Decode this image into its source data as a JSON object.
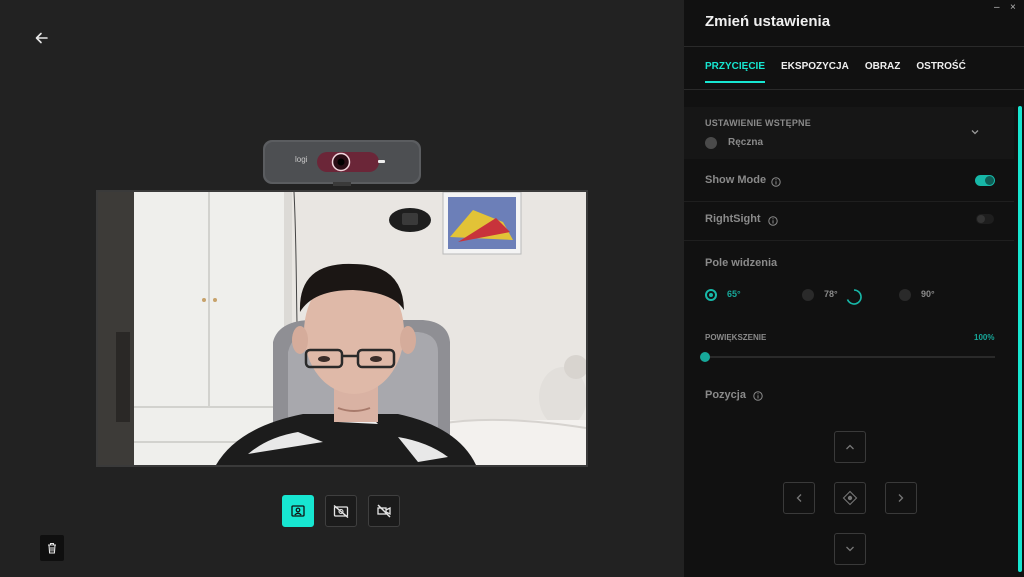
{
  "panel": {
    "title": "Zmień ustawienia",
    "tabs": [
      {
        "label": "PRZYCIĘCIE",
        "active": true
      },
      {
        "label": "EKSPOZYCJA",
        "active": false
      },
      {
        "label": "OBRAZ",
        "active": false
      },
      {
        "label": "OSTROŚĆ",
        "active": false
      }
    ],
    "preset": {
      "label": "USTAWIENIE WSTĘPNE",
      "value": "Ręczna"
    },
    "show_mode": {
      "label": "Show Mode",
      "enabled": true
    },
    "rightsight": {
      "label": "RightSight",
      "enabled": false
    },
    "fov": {
      "label": "Pole widzenia",
      "options": [
        {
          "label": "65°",
          "selected": true
        },
        {
          "label": "78°",
          "selected": false
        },
        {
          "label": "90°",
          "selected": false
        }
      ]
    },
    "zoom": {
      "label": "POWIĘKSZENIE",
      "value": "100%",
      "level": 0
    },
    "position": {
      "label": "Pozycja"
    }
  },
  "webcam": {
    "brand": "logi"
  },
  "colors": {
    "accent": "#17e6d1",
    "accent_dim": "#17a89a",
    "panel_bg": "#111111",
    "main_bg": "#222222"
  },
  "icons": {
    "back": "arrow-left-icon",
    "preview_controls": [
      "portrait-frame-icon",
      "camera-off-icon",
      "video-mute-icon"
    ],
    "trash": "trash-icon",
    "info": "info-circle-icon",
    "dpad": [
      "chevron-up-icon",
      "chevron-left-icon",
      "center-target-icon",
      "chevron-right-icon",
      "chevron-down-icon"
    ]
  }
}
